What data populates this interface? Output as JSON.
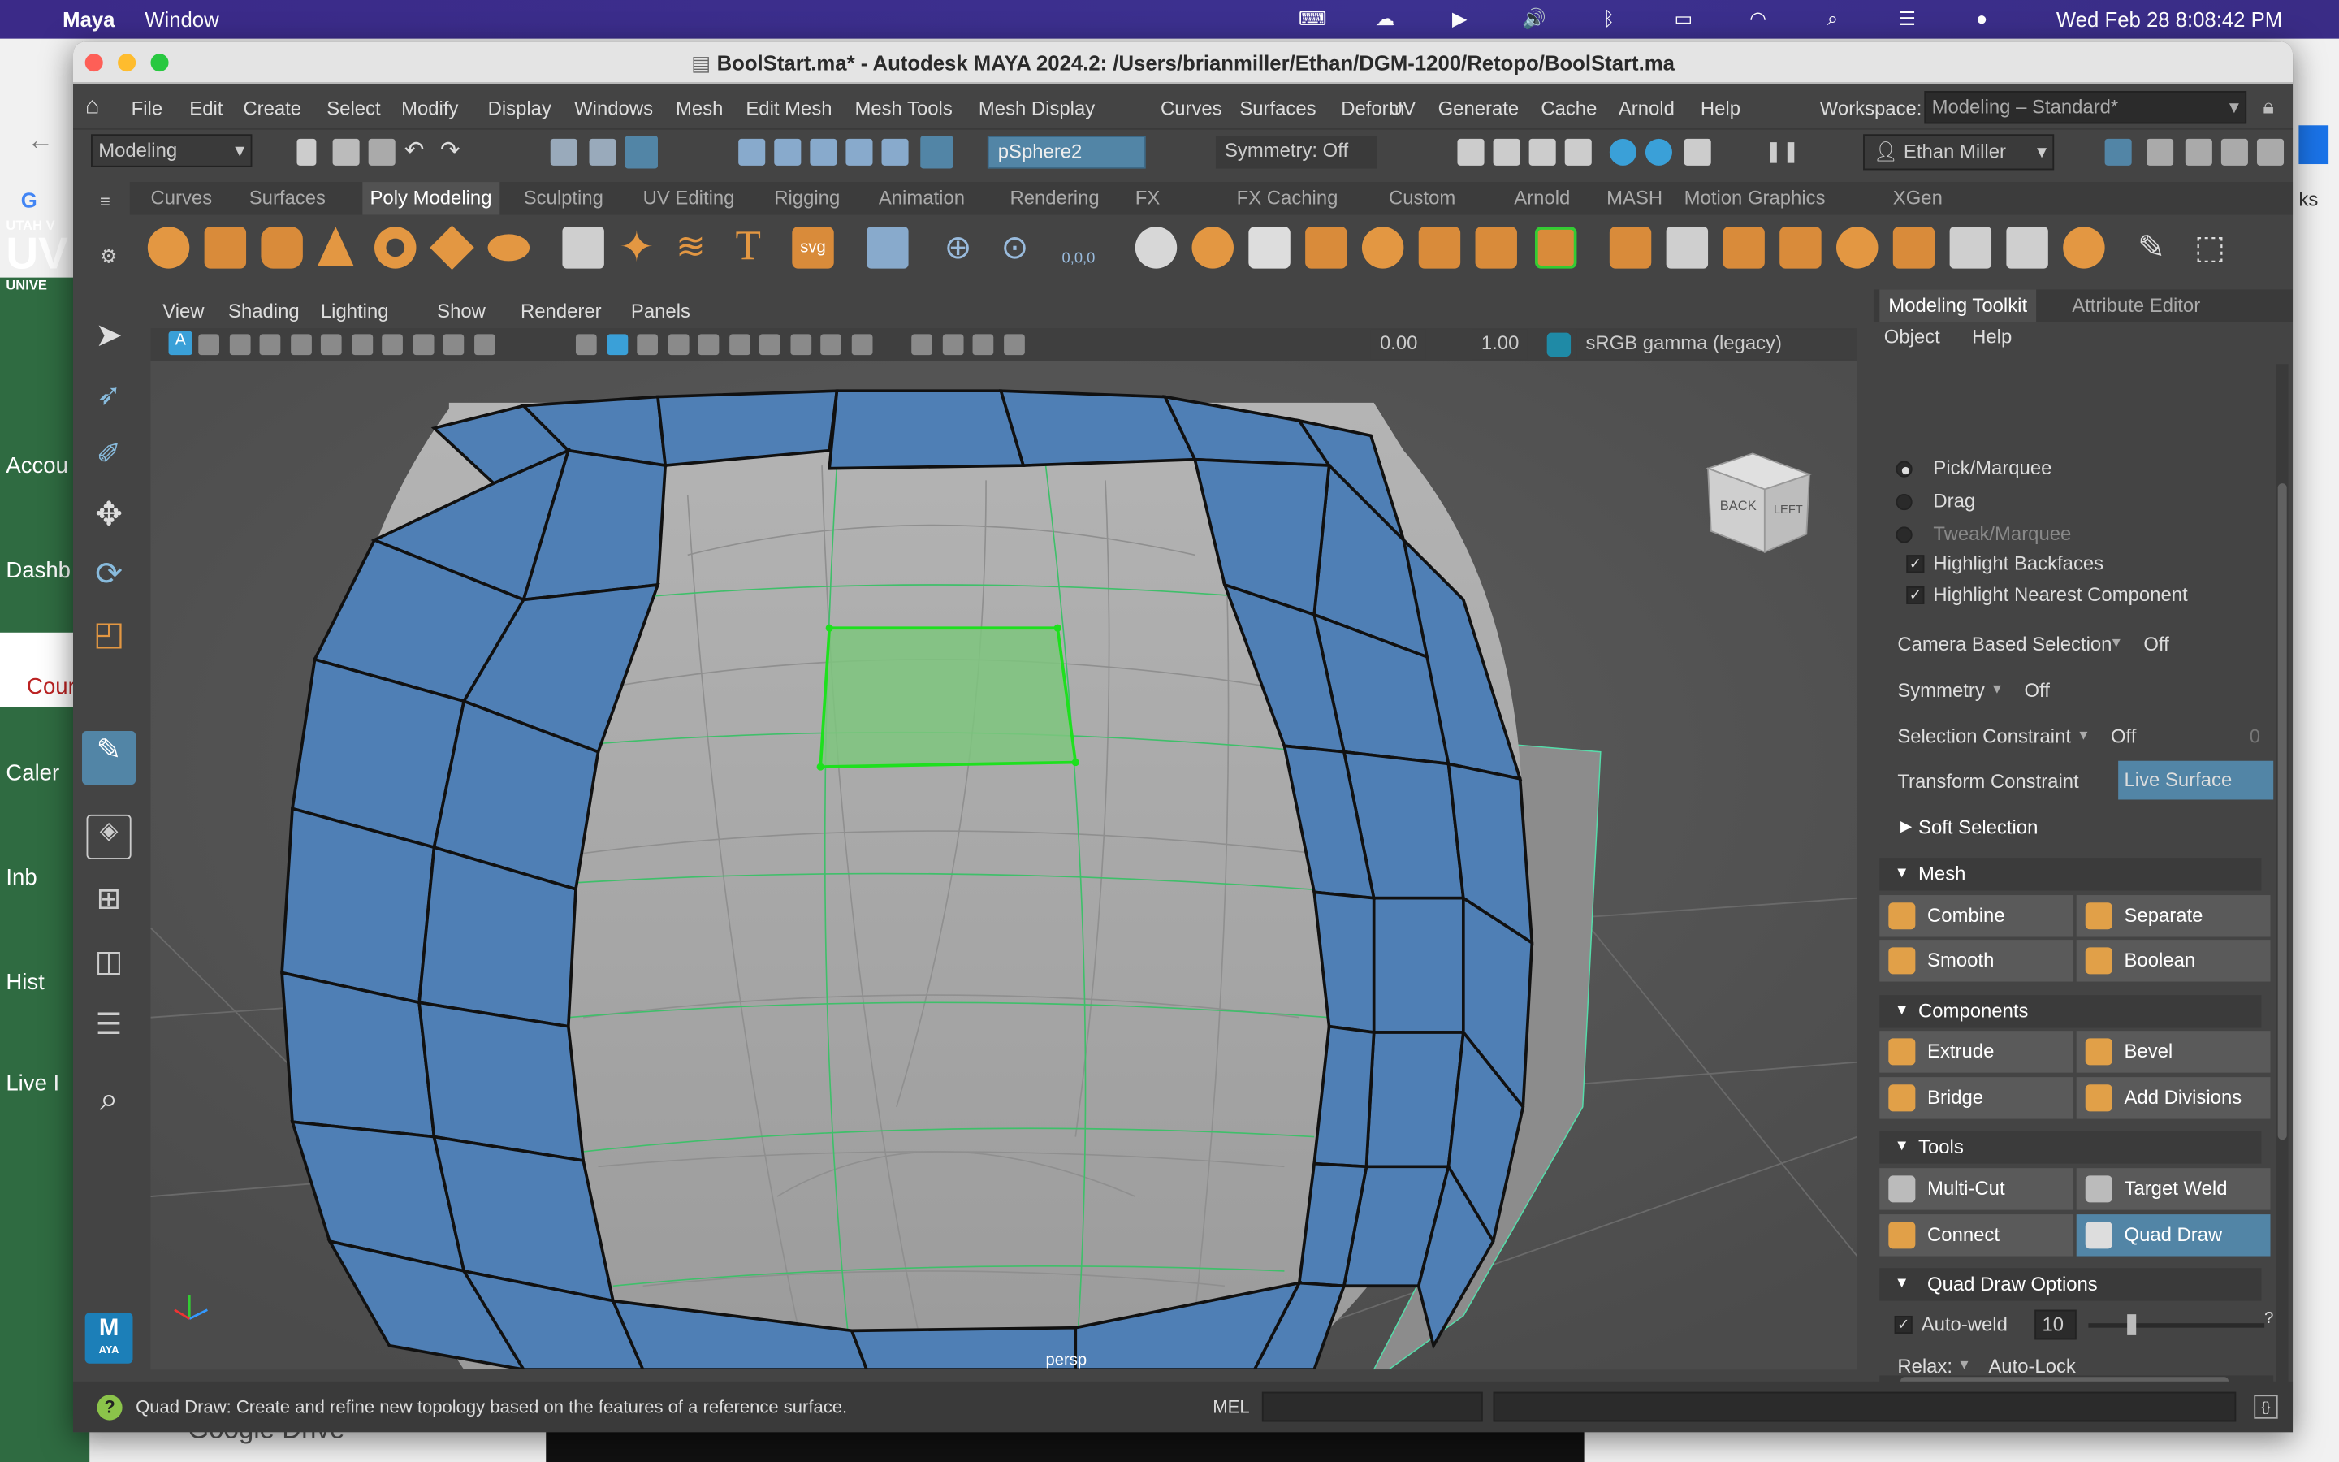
{
  "mac_menubar": {
    "app": "Maya",
    "menu": "Window",
    "clock": "Wed Feb 28  8:08:42 PM",
    "icons": [
      "apple-icon",
      "kbd-icon",
      "cloud-icon",
      "play-icon",
      "volume-icon",
      "bluetooth-icon",
      "battery-icon",
      "wifi-icon",
      "search-icon",
      "control-center-icon",
      "siri-icon"
    ]
  },
  "background_browser": {
    "sidebar_items": [
      "Accou",
      "Dashb",
      "Cour",
      "Caler",
      "Inb",
      "Hist",
      "Live I"
    ],
    "logo_text": "UTAH V UV UNIVE",
    "google_text": "G",
    "bottom_text": "Google Drive",
    "k_text": "ks"
  },
  "window": {
    "title": "BoolStart.ma* - Autodesk MAYA 2024.2: /Users/brianmiller/Ethan/DGM-1200/Retopo/BoolStart.ma"
  },
  "menubar": {
    "items": [
      "File",
      "Edit",
      "Create",
      "Select",
      "Modify",
      "Display",
      "Windows",
      "Mesh",
      "Edit Mesh",
      "Mesh Tools",
      "Mesh Display",
      "Curves",
      "Surfaces",
      "Deform",
      "UV",
      "Generate",
      "Cache",
      "Arnold",
      "Help"
    ],
    "workspace_label": "Workspace:",
    "workspace_value": "Modeling – Standard*"
  },
  "statusline": {
    "menuset": "Modeling",
    "object_field": "pSphere2",
    "symmetry": "Symmetry: Off",
    "user": "Ethan Miller"
  },
  "shelf": {
    "tabs": [
      "Curves",
      "Surfaces",
      "Poly Modeling",
      "Sculpting",
      "UV Editing",
      "Rigging",
      "Animation",
      "Rendering",
      "FX",
      "FX Caching",
      "Custom",
      "Arnold",
      "MASH",
      "Motion Graphics",
      "XGen"
    ],
    "active_tab": "Poly Modeling",
    "text_tool": "T",
    "svg_tool": "svg",
    "coord_tool": "0,0,0"
  },
  "viewport": {
    "menu": [
      "View",
      "Shading",
      "Lighting",
      "Show",
      "Renderer",
      "Panels"
    ],
    "exposure": "0.00",
    "gamma": "1.00",
    "color_space": "sRGB gamma (legacy)",
    "camera_label": "persp",
    "viewcube_back": "BACK",
    "viewcube_left": "LEFT"
  },
  "right_panel": {
    "tabs": [
      "Modeling Toolkit",
      "Attribute Editor"
    ],
    "menu": [
      "Object",
      "Help"
    ],
    "pick_options": [
      {
        "label": "Pick/Marquee",
        "on": true
      },
      {
        "label": "Drag",
        "on": false
      },
      {
        "label": "Tweak/Marquee",
        "on": false
      }
    ],
    "checks": [
      "Highlight Backfaces",
      "Highlight Nearest Component"
    ],
    "camera_based_selection": {
      "label": "Camera Based Selection",
      "value": "Off"
    },
    "symmetry": {
      "label": "Symmetry",
      "value": "Off"
    },
    "selection_constraint": {
      "label": "Selection Constraint",
      "value": "Off",
      "count": "0"
    },
    "transform_constraint": {
      "label": "Transform Constraint",
      "value": "Live Surface"
    },
    "soft_selection": "Soft Selection",
    "mesh_section": "Mesh",
    "mesh_buttons": [
      "Combine",
      "Separate",
      "Smooth",
      "Boolean"
    ],
    "components_section": "Components",
    "component_buttons": [
      "Extrude",
      "Bevel",
      "Bridge",
      "Add Divisions"
    ],
    "tools_section": "Tools",
    "tool_buttons": [
      "Multi-Cut",
      "Target Weld",
      "Connect",
      "Quad Draw"
    ],
    "active_tool": "Quad Draw",
    "quad_draw_options": "Quad Draw Options",
    "auto_weld_label": "Auto-weld",
    "auto_weld_value": "10",
    "auto_weld_slider": 0.22,
    "relax_label": "Relax:",
    "relax_value": "Auto-Lock"
  },
  "helpline": {
    "text": "Quad Draw: Create and refine new topology based on the features of a reference surface.",
    "mel": "MEL",
    "q": "?"
  },
  "colors": {
    "face_blue": "#4f7fb5",
    "selected_face": "#7ec67e",
    "panel": "#444444",
    "accent": "#5285a6"
  }
}
